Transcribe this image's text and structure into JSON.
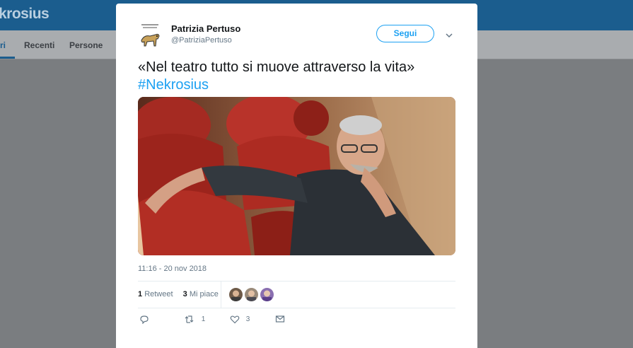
{
  "background": {
    "title": "krosius",
    "tabs": [
      "ri",
      "Recenti",
      "Persone"
    ]
  },
  "tweet": {
    "author_name": "Patrizia Pertuso",
    "author_handle": "@PatriziaPertuso",
    "follow_label": "Segui",
    "text": "«Nel teatro tutto si muove attraverso la vita»",
    "hashtag": "#Nekrosius",
    "timestamp": "11:16 - 20 nov 2018",
    "retweet_count": "1",
    "retweet_label": "Retweet",
    "like_count": "3",
    "like_label": "Mi piace",
    "action_retweets": "1",
    "action_likes": "3"
  },
  "colors": {
    "accent": "#1da1f2",
    "header": "#1b5d8e"
  }
}
